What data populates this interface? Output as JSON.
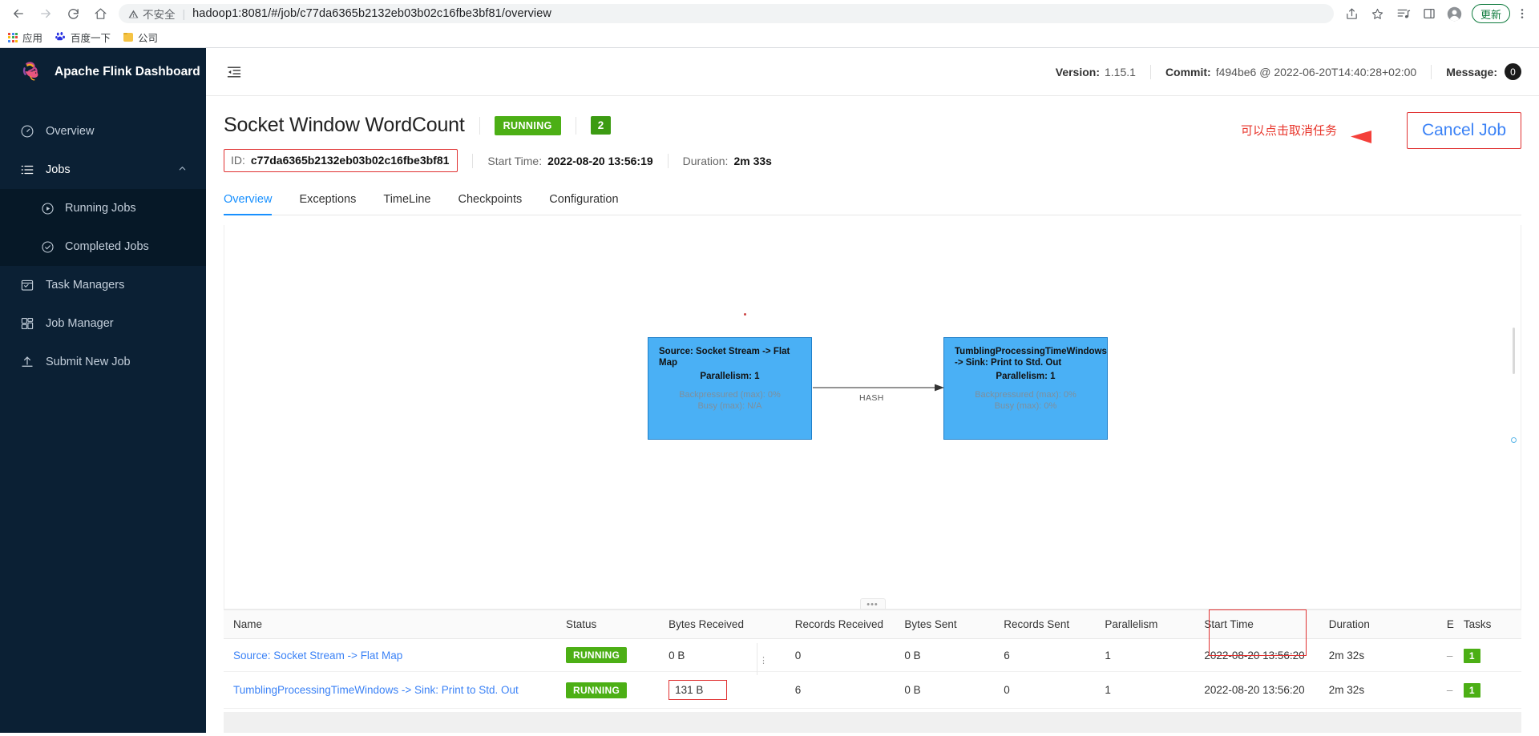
{
  "browser": {
    "back_icon": "arrow-left-icon",
    "forward_icon": "arrow-right-icon",
    "reload_icon": "reload-icon",
    "home_icon": "home-icon",
    "security_warning": "不安全",
    "url": "hadoop1:8081/#/job/c77da6365b2132eb03b02c16fbe3bf81/overview",
    "share_icon": "share-icon",
    "bookmark_star_icon": "star-icon",
    "reading_list_icon": "media-list-icon",
    "sidepanel_icon": "side-panel-icon",
    "profile_icon": "profile-avatar-icon",
    "update_label": "更新",
    "menu_icon": "three-dot-menu-icon",
    "bookmarks": [
      {
        "label": "应用",
        "icon": "apps-grid-icon"
      },
      {
        "label": "百度一下",
        "icon": "baidu-icon"
      },
      {
        "label": "公司",
        "icon": "folder-icon"
      }
    ]
  },
  "sidebar": {
    "brand": "Apache Flink Dashboard",
    "logo_icon": "flink-squirrel-logo",
    "items": [
      {
        "label": "Overview",
        "icon": "dashboard-icon"
      },
      {
        "label": "Jobs",
        "icon": "list-icon",
        "expanded": true,
        "chevron": "chevron-up-icon"
      },
      {
        "label": "Task Managers",
        "icon": "task-manager-icon"
      },
      {
        "label": "Job Manager",
        "icon": "job-manager-icon"
      },
      {
        "label": "Submit New Job",
        "icon": "upload-icon"
      }
    ],
    "sub_items": [
      {
        "label": "Running Jobs",
        "icon": "play-circle-icon"
      },
      {
        "label": "Completed Jobs",
        "icon": "check-circle-icon"
      }
    ]
  },
  "topbar": {
    "collapse_icon": "menu-fold-icon",
    "version_label": "Version:",
    "version_value": "1.15.1",
    "commit_label": "Commit:",
    "commit_value": "f494be6 @ 2022-06-20T14:40:28+02:00",
    "message_label": "Message:",
    "message_count": "0"
  },
  "job": {
    "name": "Socket Window WordCount",
    "status": "RUNNING",
    "task_count": "2",
    "id_label": "ID:",
    "id_value": "c77da6365b2132eb03b02c16fbe3bf81",
    "start_time_label": "Start Time:",
    "start_time_value": "2022-08-20 13:56:19",
    "duration_label": "Duration:",
    "duration_value": "2m 33s"
  },
  "annotation": {
    "text": "可以点击取消任务",
    "arrow_icon": "left-arrow-annotation",
    "cancel_button": "Cancel Job",
    "color": "#e8362c",
    "cancel_color": "#3b82f6"
  },
  "tabs": [
    {
      "label": "Overview",
      "active": true
    },
    {
      "label": "Exceptions",
      "active": false
    },
    {
      "label": "TimeLine",
      "active": false
    },
    {
      "label": "Checkpoints",
      "active": false
    },
    {
      "label": "Configuration",
      "active": false
    }
  ],
  "graph": {
    "nodes": [
      {
        "title": "Source: Socket Stream -> Flat Map",
        "parallelism": "Parallelism: 1",
        "backpressured": "Backpressured (max): 0%",
        "busy": "Busy (max): N/A"
      },
      {
        "title": "TumblingProcessingTimeWindows -> Sink: Print to Std. Out",
        "parallelism": "Parallelism: 1",
        "backpressured": "Backpressured (max): 0%",
        "busy": "Busy (max): 0%"
      }
    ],
    "edge_label": "HASH",
    "node_color": "#4ab0f5",
    "drag_handle_icon": "resize-handle-icon"
  },
  "table": {
    "columns": [
      "Name",
      "Status",
      "Bytes Received",
      "Records Received",
      "Bytes Sent",
      "Records Sent",
      "Parallelism",
      "Start Time",
      "Duration",
      "E",
      "Tasks"
    ],
    "rows": [
      {
        "name": "Source: Socket Stream -> Flat Map",
        "status": "RUNNING",
        "bytes_received": "0 B",
        "records_received": "0",
        "bytes_sent": "0 B",
        "records_sent": "6",
        "parallelism": "1",
        "start_time": "2022-08-20 13:56:20",
        "duration": "2m 32s",
        "e": "–",
        "tasks": "1"
      },
      {
        "name": "TumblingProcessingTimeWindows -> Sink: Print to Std. Out",
        "status": "RUNNING",
        "bytes_received": "131 B",
        "records_received": "6",
        "bytes_sent": "0 B",
        "records_sent": "0",
        "parallelism": "1",
        "start_time": "2022-08-20 13:56:20",
        "duration": "2m 32s",
        "e": "–",
        "tasks": "1"
      }
    ]
  }
}
